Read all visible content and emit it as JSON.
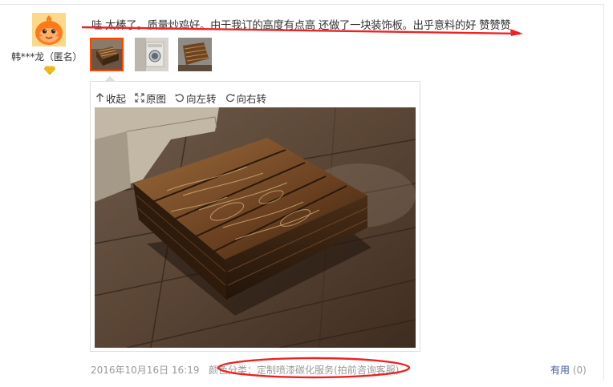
{
  "review": {
    "username": "韩***龙（匿名）",
    "text": "哇 太棒了。质量炒鸡好。由于我订的高度有点高 还做了一块装饰板。出乎意料的好 赞赞赞",
    "date": "2016年10月16日 16:19",
    "variant_label": "颜色分类：",
    "variant_value": "定制喷漆碳化服务(拍前咨询客服)",
    "useful_label": "有用",
    "useful_count": "(0)"
  },
  "viewer": {
    "tools": [
      {
        "label": "收起",
        "icon": "arrow-up-icon"
      },
      {
        "label": "原图",
        "icon": "expand-icon"
      },
      {
        "label": "向左转",
        "icon": "rotate-left-icon"
      },
      {
        "label": "向右转",
        "icon": "rotate-right-icon"
      }
    ]
  },
  "thumbnails": [
    {
      "name": "thumb-wooden-box",
      "active": true
    },
    {
      "name": "thumb-washing-machine",
      "active": false
    },
    {
      "name": "thumb-box-top",
      "active": false
    }
  ],
  "colors": {
    "annotation_red": "#e22",
    "active_border": "#ff4400",
    "link_blue": "#3c5a98",
    "muted_text": "#999999"
  }
}
